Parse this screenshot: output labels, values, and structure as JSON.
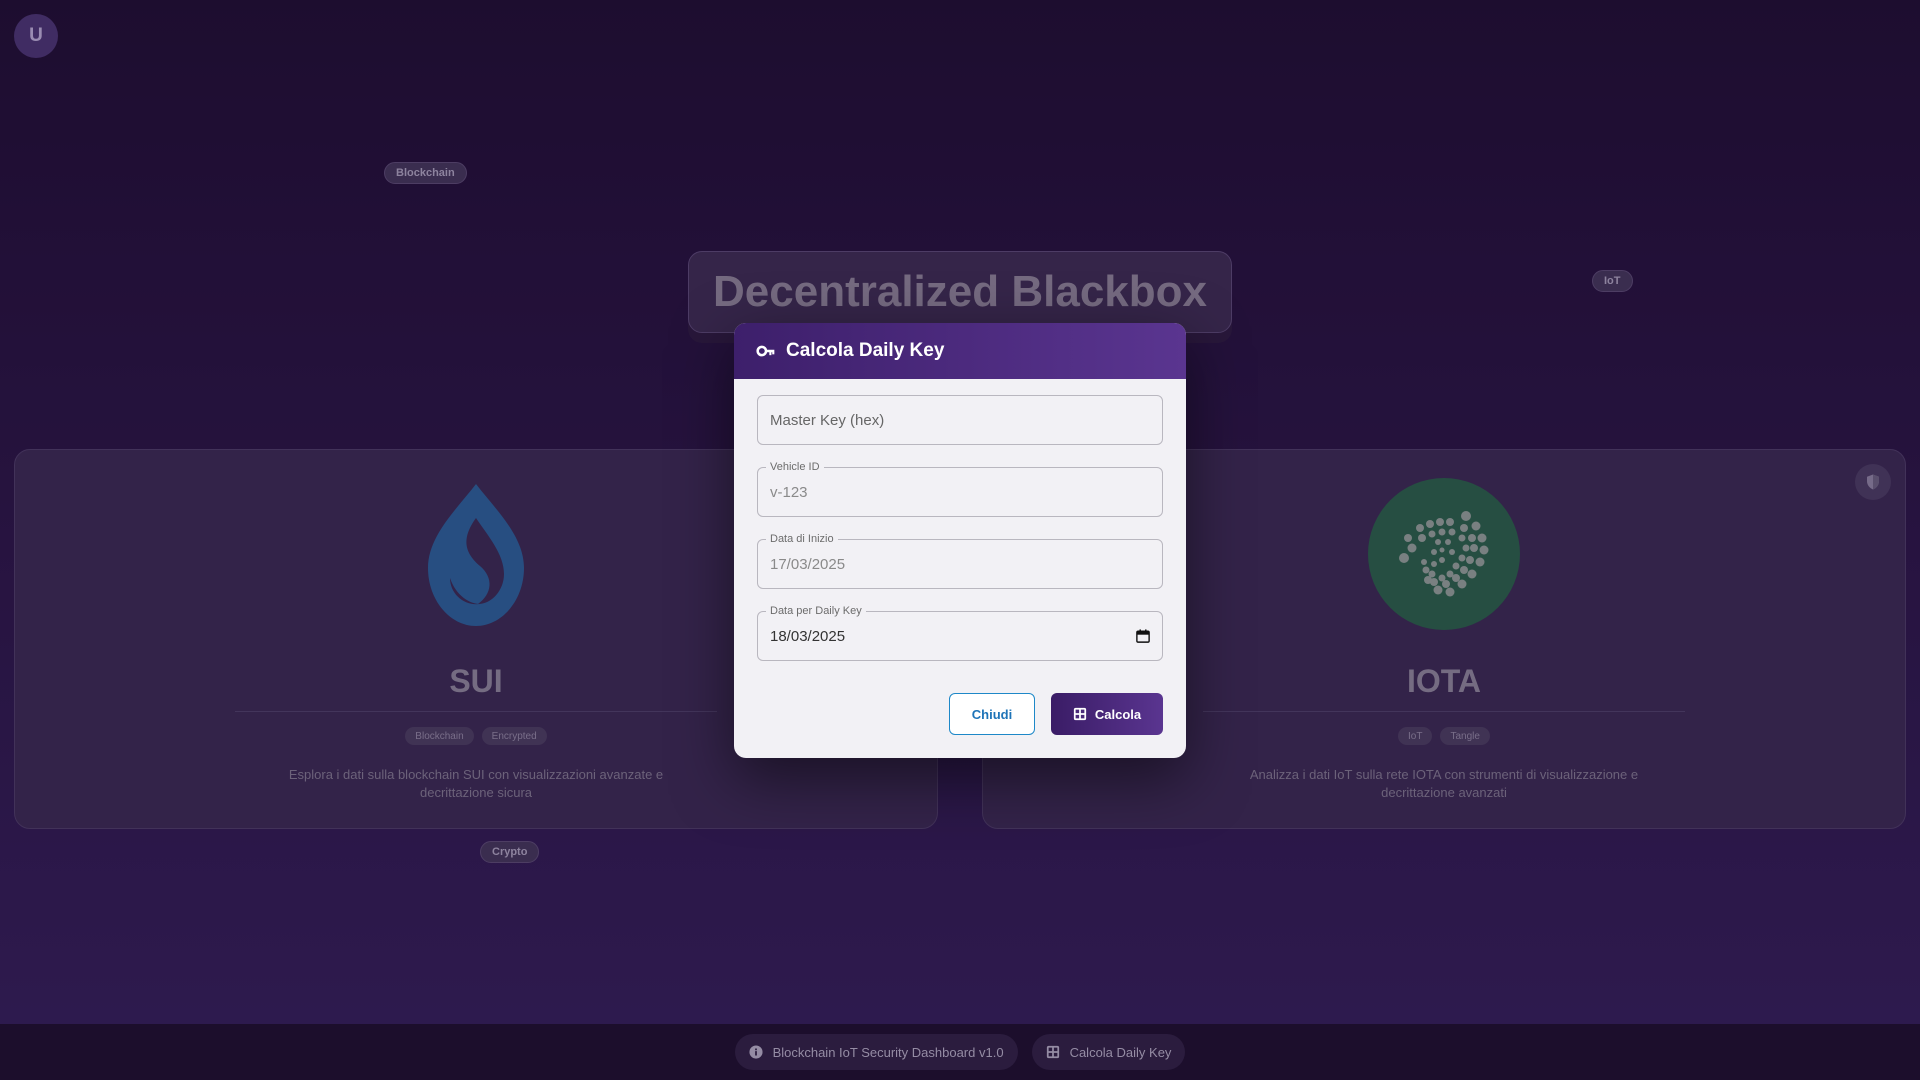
{
  "user": {
    "avatar_initial": "U"
  },
  "floating_tags": [
    "Blockchain",
    "IoT",
    "Crypto"
  ],
  "page_title": "Decentralized Blackbox",
  "cards": [
    {
      "name": "SUI",
      "tags": [
        "Blockchain",
        "Encrypted"
      ],
      "description": "Esplora i dati sulla blockchain SUI con visualizzazioni avanzate e decrittazione sicura",
      "logo_color": "#2b5f96"
    },
    {
      "name": "IOTA",
      "tags": [
        "IoT",
        "Tangle"
      ],
      "description": "Analizza i dati IoT sulla rete IOTA con strumenti di visualizzazione e decrittazione avanzati",
      "logo_color": "#2a5e4a"
    }
  ],
  "footer": {
    "version_label": "Blockchain IoT Security Dashboard v1.0",
    "daily_key_label": "Calcola Daily Key"
  },
  "modal": {
    "title": "Calcola Daily Key",
    "fields": {
      "master_key": {
        "placeholder": "Master Key (hex)",
        "value": ""
      },
      "vehicle_id": {
        "label": "Vehicle ID",
        "value": "v-123"
      },
      "start_date": {
        "label": "Data di Inizio",
        "value": "17/03/2025"
      },
      "daily_key_date": {
        "label": "Data per Daily Key",
        "value": "18/03/2025"
      }
    },
    "buttons": {
      "close": "Chiudi",
      "calculate": "Calcola"
    }
  },
  "colors": {
    "accent": "#4a2a7a",
    "close_button": "#1e88c8"
  }
}
